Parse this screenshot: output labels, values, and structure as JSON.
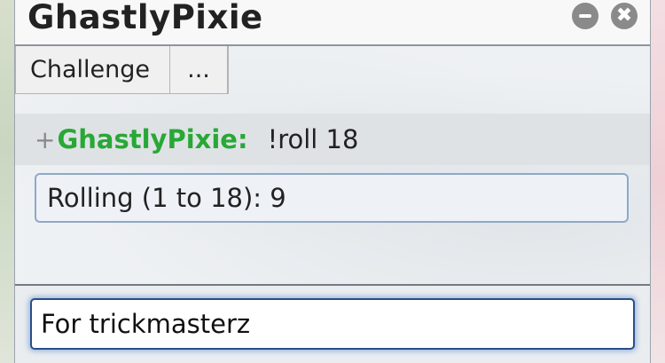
{
  "window": {
    "title": "GhastlyPixie",
    "minimize_icon": "minimize-icon",
    "close_icon": "close-icon",
    "close_glyph": "✖"
  },
  "tabs": [
    {
      "label": "Challenge"
    },
    {
      "label": "..."
    }
  ],
  "chat": {
    "messages": [
      {
        "rank": "+",
        "user": "GhastlyPixie:",
        "text": "!roll 18",
        "user_color": "#28a836"
      }
    ],
    "roll_result": "Rolling (1 to 18): 9"
  },
  "input": {
    "value": "For trickmasterz"
  }
}
